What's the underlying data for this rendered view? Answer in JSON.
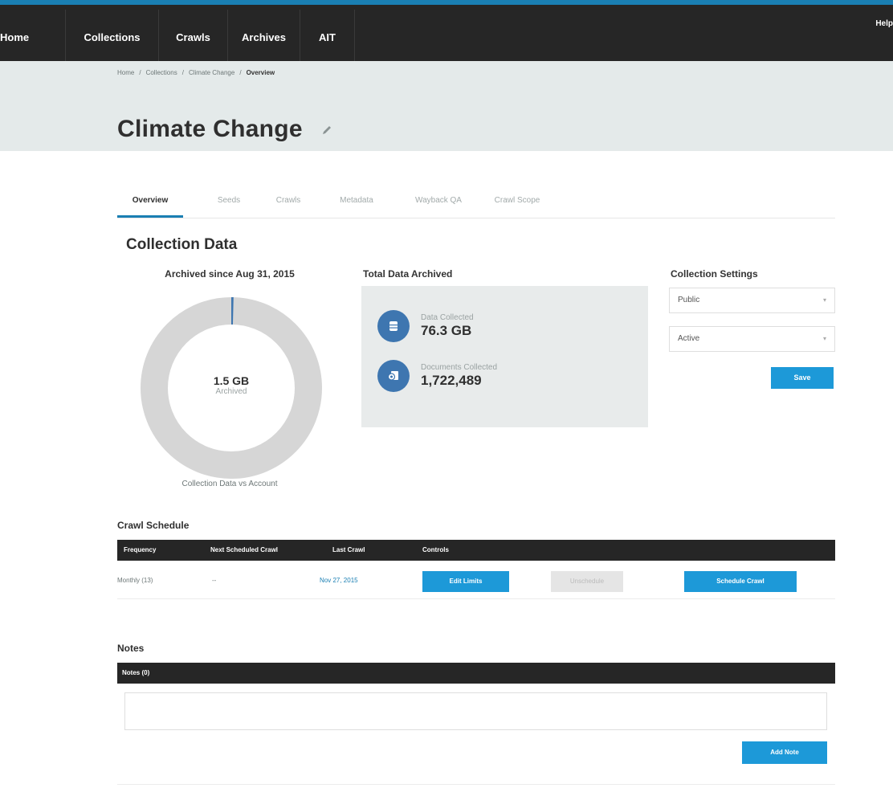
{
  "nav": {
    "items": [
      "Home",
      "Collections",
      "Crawls",
      "Archives",
      "AIT"
    ],
    "help": "Help"
  },
  "breadcrumb": [
    "Home",
    "Collections",
    "Climate Change",
    "Overview"
  ],
  "page_title": "Climate Change",
  "tabs": [
    {
      "label": "Overview",
      "active": true
    },
    {
      "label": "Seeds",
      "active": false
    },
    {
      "label": "Crawls",
      "active": false
    },
    {
      "label": "Metadata",
      "active": false
    },
    {
      "label": "Wayback QA",
      "active": false
    },
    {
      "label": "Crawl Scope",
      "active": false
    }
  ],
  "collection_data": {
    "title": "Collection Data",
    "archived_since": "Archived since Aug 31, 2015",
    "donut": {
      "value": "1.5 GB",
      "sublabel": "Archived",
      "fraction_used": 0.004,
      "caption": "Collection Data vs Account"
    },
    "total": {
      "title": "Total Data Archived",
      "data_collected_label": "Data Collected",
      "data_collected_value": "76.3 GB",
      "documents_label": "Documents Collected",
      "documents_value": "1,722,489"
    },
    "settings": {
      "title": "Collection Settings",
      "visibility": "Public",
      "status": "Active",
      "save_label": "Save"
    }
  },
  "crawl_schedule": {
    "title": "Crawl Schedule",
    "headers": [
      "Frequency",
      "Next Scheduled Crawl",
      "Last Crawl",
      "Controls"
    ],
    "row": {
      "frequency": "Monthly (13)",
      "next": "--",
      "last": "Nov 27, 2015",
      "edit_limits": "Edit Limits",
      "unschedule": "Unschedule",
      "schedule_crawl": "Schedule Crawl"
    }
  },
  "notes": {
    "title": "Notes",
    "header": "Notes (0)",
    "add_label": "Add Note"
  },
  "colors": {
    "accent": "#1d99d8",
    "nav_bg": "#262626",
    "donut_track": "#d6d6d6",
    "donut_fill": "#3e76b0",
    "stat_icon": "#3e76b0"
  }
}
